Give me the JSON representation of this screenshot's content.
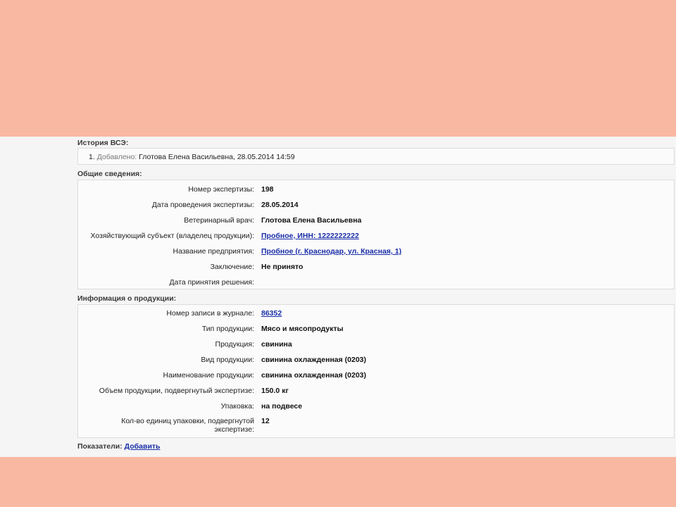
{
  "history": {
    "title": "История ВСЭ:",
    "items": [
      {
        "index": "1.",
        "action": "Добавлено:",
        "text": "Глотова Елена Васильевна, 28.05.2014 14:59"
      }
    ]
  },
  "general": {
    "title": "Общие сведения:",
    "rows": [
      {
        "label": "Номер экспертизы:",
        "value": "198"
      },
      {
        "label": "Дата проведения экспертизы:",
        "value": "28.05.2014"
      },
      {
        "label": "Ветеринарный врач:",
        "value": "Глотова Елена Васильевна"
      },
      {
        "label": "Хозяйствующий субъект (владелец продукции):",
        "value": "Пробное, ИНН: 1222222222"
      },
      {
        "label": "Название предприятия:",
        "value": "Пробное (г. Краснодар, ул. Красная, 1)"
      },
      {
        "label": "Заключение:",
        "value": "Не принято"
      },
      {
        "label": "Дата принятия решения:",
        "value": ""
      }
    ]
  },
  "product": {
    "title": "Информация о продукции:",
    "rows": [
      {
        "label": "Номер записи в журнале:",
        "value": "86352"
      },
      {
        "label": "Тип продукции:",
        "value": "Мясо и мясопродукты"
      },
      {
        "label": "Продукция:",
        "value": "свинина"
      },
      {
        "label": "Вид продукции:",
        "value": "свинина охлажденная (0203)"
      },
      {
        "label": "Наименование продукции:",
        "value": "свинина охлажденная (0203)"
      },
      {
        "label": "Объем продукции, подвергнутый экспертизе:",
        "value": "150.0 кг"
      },
      {
        "label": "Упаковка:",
        "value": "на подвесе"
      },
      {
        "label_line1": "Кол-во единиц упаковки, подвергнутой",
        "label_line2": "экспертизе:",
        "value": "12"
      }
    ]
  },
  "indicators": {
    "label": "Показатели:",
    "add_link": "Добавить"
  }
}
